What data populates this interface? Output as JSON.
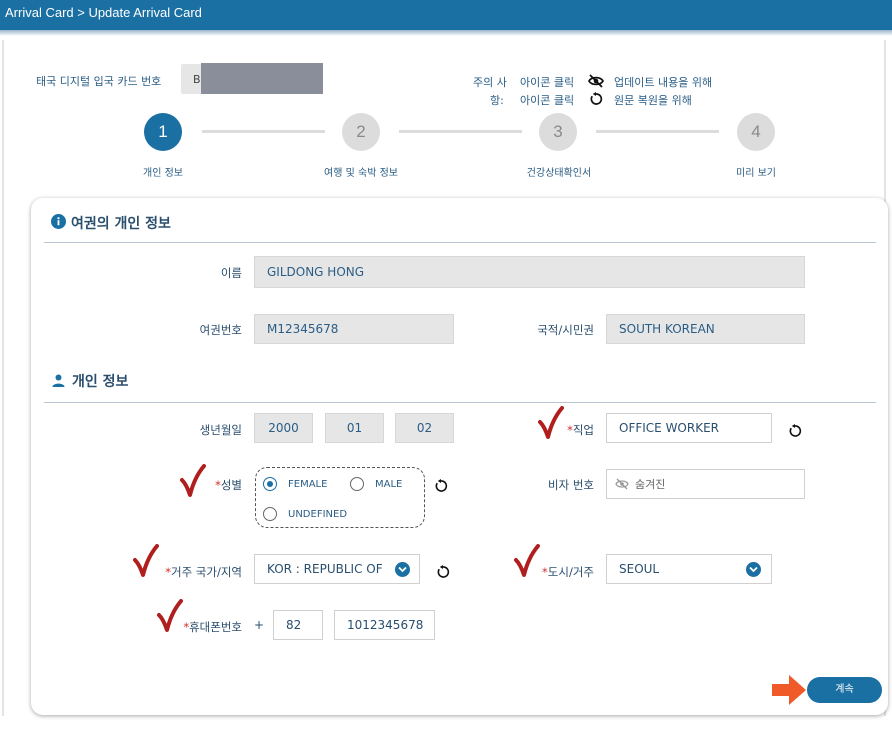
{
  "header": {
    "breadcrumb": "Arrival Card > Update Arrival Card"
  },
  "card_ref": {
    "label": "태국 디지털 입국 카드 번호",
    "prefix": "B"
  },
  "notes": {
    "label_line1": "주의 사",
    "label_line2": "항:",
    "line1_prefix": "아이콘 클릭",
    "line1_suffix": "업데이트 내용을 위해",
    "line2_prefix": "아이콘 클릭",
    "line2_suffix": "원문 복원을 위해"
  },
  "steps": [
    {
      "number": "1",
      "label": "개인 정보"
    },
    {
      "number": "2",
      "label": "여행 및 숙박 정보"
    },
    {
      "number": "3",
      "label": "건강상태확인서"
    },
    {
      "number": "4",
      "label": "미리 보기"
    }
  ],
  "passport_section": {
    "title": "여권의 개인 정보",
    "name_label": "이름",
    "name_value": "GILDONG HONG",
    "passport_label": "여권번호",
    "passport_value": "M12345678",
    "nationality_label": "국적/시민권",
    "nationality_value": "SOUTH KOREAN"
  },
  "personal_section": {
    "title": "개인 정보",
    "dob_label": "생년월일",
    "dob_year": "2000",
    "dob_month": "01",
    "dob_day": "02",
    "occupation_label": "직업",
    "occupation_value": "OFFICE WORKER",
    "gender_label": "성별",
    "gender_options": [
      "FEMALE",
      "MALE",
      "UNDEFINED"
    ],
    "gender_selected": "FEMALE",
    "visa_label": "비자 번호",
    "visa_value": "숨겨진",
    "residence_country_label": "거주 국가/지역",
    "residence_country_value": "KOR : REPUBLIC OF",
    "city_label": "도시/거주",
    "city_value": "SEOUL",
    "phone_label": "휴대폰번호",
    "phone_plus": "+",
    "phone_code": "82",
    "phone_number": "1012345678",
    "required_mark": "*"
  },
  "actions": {
    "continue_label": "계속"
  },
  "colors": {
    "primary": "#1a6fa3",
    "check_red": "#b01e1e",
    "arrow_orange": "#f05a28"
  }
}
